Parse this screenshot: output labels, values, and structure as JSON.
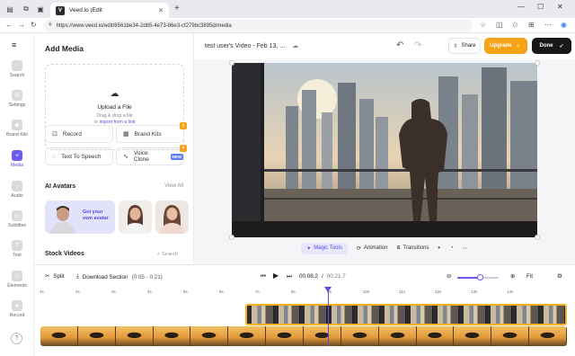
{
  "browser": {
    "tab_title": "Veed.io (Edit",
    "url": "https://www.veed.io/edit/8561be34-2db5-4e73-86e3-cf279bc3895d/media"
  },
  "rail": [
    {
      "label": "Search",
      "icon": "search-icon"
    },
    {
      "label": "Settings",
      "icon": "gear-icon"
    },
    {
      "label": "Brand Kits",
      "icon": "brand-kit-icon"
    },
    {
      "label": "Media",
      "icon": "plus-icon",
      "active": true
    },
    {
      "label": "Audio",
      "icon": "music-icon"
    },
    {
      "label": "Subtitles",
      "icon": "subtitles-icon"
    },
    {
      "label": "Text",
      "icon": "text-icon"
    },
    {
      "label": "Elements",
      "icon": "elements-icon"
    },
    {
      "label": "Record",
      "icon": "record-icon"
    }
  ],
  "panel": {
    "title": "Add Media",
    "upload": {
      "title": "Upload a File",
      "hint1": "Drag & drop a file",
      "hint2_prefix": "or ",
      "hint2_link": "import from a link"
    },
    "tools": [
      {
        "label": "Record",
        "icon": "record-icon"
      },
      {
        "label": "Brand Kits",
        "icon": "brand-kit-icon",
        "badge": "4"
      },
      {
        "label": "Text To Speech",
        "icon": "speech-icon"
      },
      {
        "label": "Voice Clone",
        "icon": "waveform-icon",
        "tag": "NEW",
        "badge": "4"
      }
    ],
    "avatars_title": "AI Avatars",
    "view_all": "View All",
    "avatar_promo": "Get your own avatar",
    "stock_title": "Stock Videos",
    "stock_search": "Search"
  },
  "header": {
    "project_title": "test user's Video - Feb 13, ...",
    "share": "Share",
    "upgrade": "Upgrade",
    "done": "Done"
  },
  "video_tools": {
    "magic": "Magic Tools",
    "animation": "Animation",
    "transitions": "Transitions"
  },
  "timeline": {
    "split": "Split",
    "download_section": "Download Section",
    "section_range": "(0:05 - 0:21)",
    "current_time": "00:08.2",
    "separator": "/",
    "total_time": "00:21.7",
    "zoom_fit": "Fit",
    "zoom_level": 0.55,
    "ruler": [
      "1s",
      "2s",
      "3s",
      "4s",
      "5s",
      "6s",
      "7s",
      "8s",
      "9s",
      "10s",
      "11s",
      "12s",
      "13s",
      "14s"
    ]
  },
  "colors": {
    "accent": "#6a5cf0",
    "upgrade": "#f7a31a",
    "done": "#18181b"
  }
}
